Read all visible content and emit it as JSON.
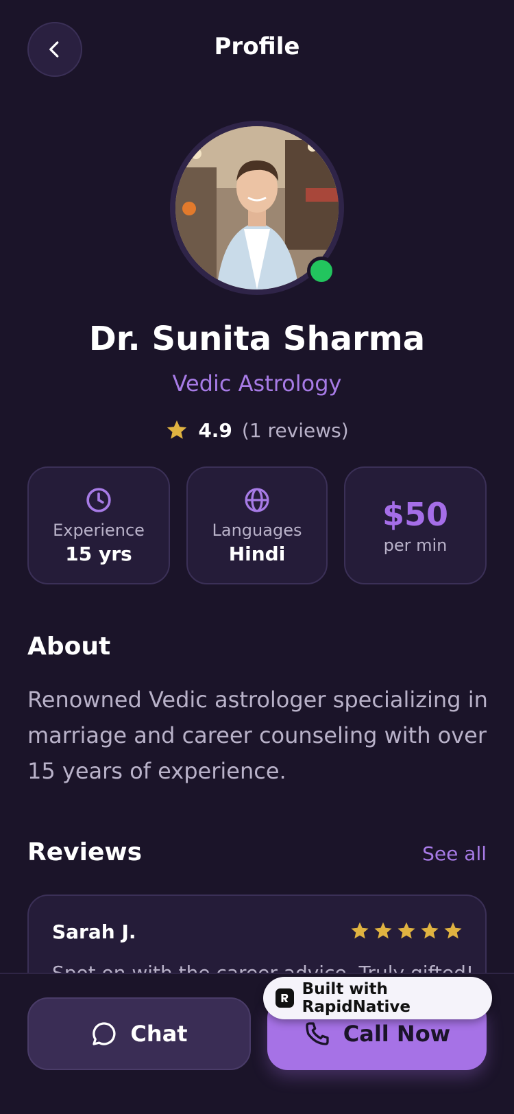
{
  "header": {
    "title": "Profile"
  },
  "profile": {
    "name": "Dr. Sunita Sharma",
    "specialty": "Vedic Astrology",
    "rating": "4.9",
    "review_count": "(1 reviews)",
    "online": true
  },
  "stats": {
    "experience": {
      "label": "Experience",
      "value": "15 yrs",
      "icon": "clock-icon"
    },
    "languages": {
      "label": "Languages",
      "value": "Hindi",
      "icon": "globe-icon"
    },
    "price": {
      "value": "$50",
      "unit": "per min"
    }
  },
  "about": {
    "title": "About",
    "text": "Renowned Vedic astrologer specializing in marriage and career counseling with over 15 years of experience."
  },
  "reviews": {
    "title": "Reviews",
    "see_all": "See all",
    "items": [
      {
        "name": "Sarah J.",
        "stars": 5,
        "text": "Spot on with the career advice. Truly gifted!"
      }
    ]
  },
  "actions": {
    "chat": "Chat",
    "call": "Call Now"
  },
  "badge": {
    "text": "Built with RapidNative"
  },
  "colors": {
    "background": "#1b1429",
    "card": "#251c39",
    "accent": "#a77be6",
    "star": "#e0b341",
    "online": "#22c55e"
  }
}
